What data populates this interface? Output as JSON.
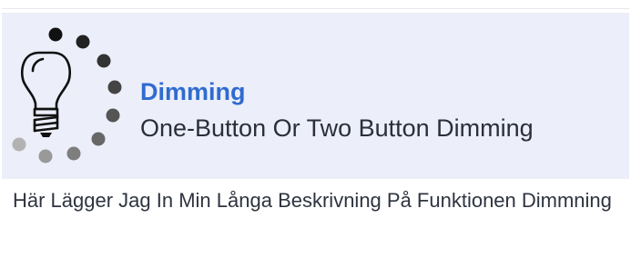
{
  "feature": {
    "title": "Dimming",
    "subtitle": "One-Button Or Two Button Dimming",
    "description": "Här Lägger Jag In Min Långa Beskrivning På Funktionen Dimmning",
    "icon": "dimmer-bulb-icon"
  },
  "colors": {
    "banner_background": "#eceef9",
    "title": "#2f6bd0",
    "subtitle": "#2a2f3a",
    "description": "#2e3440"
  }
}
